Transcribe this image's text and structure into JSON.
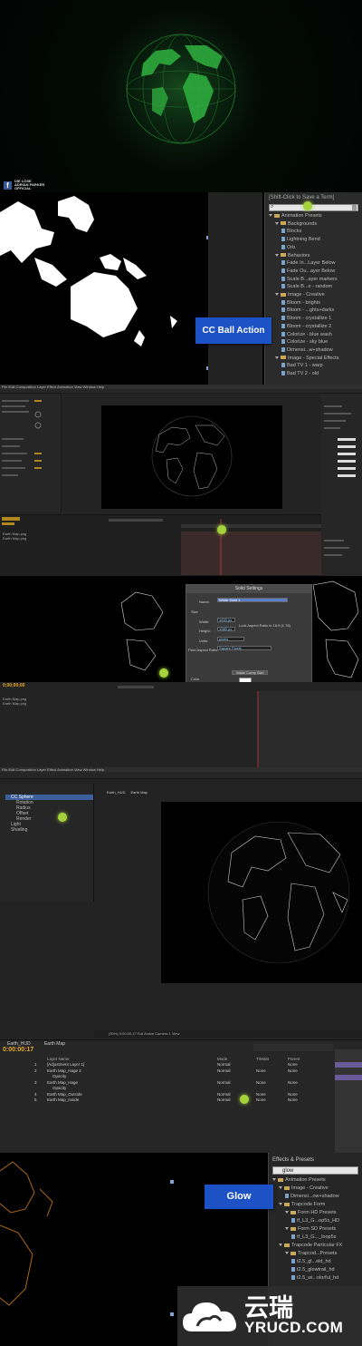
{
  "panel1": {
    "brand_line1": "DIE LOSE",
    "brand_line2": "ADRIAN PARKER",
    "brand_line3": "OFFICIAL"
  },
  "panel2": {
    "search_hint": "[Shift-Click to Save a Term]",
    "callout": "CC Ball Action",
    "tree": [
      {
        "label": "Animation Presets",
        "kind": "folder",
        "indent": 0
      },
      {
        "label": "Backgrounds",
        "kind": "folder",
        "indent": 1
      },
      {
        "label": "Blocks",
        "kind": "file",
        "indent": 2
      },
      {
        "label": "Lightning Bend",
        "kind": "file",
        "indent": 2
      },
      {
        "label": "Orb",
        "kind": "file",
        "indent": 2
      },
      {
        "label": "Behaviors",
        "kind": "folder",
        "indent": 1
      },
      {
        "label": "Fade In...Layer Below",
        "kind": "file",
        "indent": 2
      },
      {
        "label": "Fade Ou...ayer Below",
        "kind": "file",
        "indent": 2
      },
      {
        "label": "Scale B...ayer markers",
        "kind": "file",
        "indent": 2
      },
      {
        "label": "Scale B...e - random",
        "kind": "file",
        "indent": 2
      },
      {
        "label": "Image - Creative",
        "kind": "folder",
        "indent": 1
      },
      {
        "label": "Bloom - brights",
        "kind": "file",
        "indent": 2
      },
      {
        "label": "Bloom - ...ghts+darks",
        "kind": "file",
        "indent": 2
      },
      {
        "label": "Bloom - crystallize 1",
        "kind": "file",
        "indent": 2
      },
      {
        "label": "Bloom - crystallize 2",
        "kind": "file",
        "indent": 2
      },
      {
        "label": "Colorize - blue wash",
        "kind": "file",
        "indent": 2
      },
      {
        "label": "Colorize - sky blue",
        "kind": "file",
        "indent": 2
      },
      {
        "label": "Dimensi...w+shadow",
        "kind": "file",
        "indent": 2
      },
      {
        "label": "Image - Special Effects",
        "kind": "folder",
        "indent": 1
      },
      {
        "label": "Bad TV 1 - warp",
        "kind": "file",
        "indent": 2
      },
      {
        "label": "Bad TV 2 - old",
        "kind": "file",
        "indent": 2
      }
    ]
  },
  "panel3": {
    "menu": "File  Edit  Composition  Layer  Effect  Animation  View  Window  Help",
    "layers": [
      "Earth Map.png",
      "Earth Map.png"
    ]
  },
  "panel4": {
    "dialog_title": "Solid Settings",
    "name_label": "Name:",
    "name_value": "White Solid 1",
    "size_label": "Size",
    "width_label": "Width:",
    "width_value": "1920 px",
    "height_label": "Height:",
    "height_value": "1080 px",
    "units_label": "Units:",
    "units_value": "pixels",
    "par_label": "Pixel Aspect Ratio:",
    "par_value": "Square Pixels",
    "lock_label": "Lock Aspect Ratio to 16:9 (1.78)",
    "make_comp_size": "Make Comp Size",
    "color_label": "Color",
    "preview_label": "Preview",
    "ok": "OK",
    "cancel": "Cancel",
    "timecode": "0;00;00;00",
    "layers": [
      "Earth Map.png",
      "Earth Map.png"
    ]
  },
  "panel5": {
    "menu": "File  Edit  Composition  Layer  Effect  Animation  View  Window  Help",
    "effect_controls": "Effect Controls: Earth Map_Hage",
    "effect_tree": [
      "CC Sphere",
      "Rotation",
      "Radius",
      "Offset",
      "Render",
      "Light",
      "Shading"
    ],
    "comp_tabs": [
      "Earth_HUD",
      "Earth Map"
    ],
    "viewer_bar": "(50%)   0;00;00;17   Full   Active Camera   1 View",
    "timecode": "0:00:00:17",
    "tl_tabs": [
      "Earth_HUD",
      "Earth Map"
    ],
    "columns": {
      "name": "Layer Name",
      "mode": "Mode",
      "trkmat": "TrkMat",
      "parent": "Parent"
    },
    "rows": [
      {
        "num": "1",
        "name": "[Adjustment Layer 1]",
        "mode": "Normal",
        "trk": "",
        "parent": "None"
      },
      {
        "num": "2",
        "name": "Earth Map_Hage 2",
        "mode": "Normal",
        "trk": "None",
        "parent": "None"
      },
      {
        "num": "",
        "name": "Opacity",
        "mode": "",
        "trk": "",
        "parent": ""
      },
      {
        "num": "3",
        "name": "Earth Map_Hage",
        "mode": "Normal",
        "trk": "None",
        "parent": "None"
      },
      {
        "num": "",
        "name": "Opacity",
        "mode": "",
        "trk": "",
        "parent": ""
      },
      {
        "num": "4",
        "name": "Earth Map_Outside",
        "mode": "Normal",
        "trk": "None",
        "parent": "None"
      },
      {
        "num": "5",
        "name": "Earth Map_Inside",
        "mode": "Normal",
        "trk": "None",
        "parent": "None"
      }
    ]
  },
  "panel6": {
    "title": "Effects & Presets",
    "search_value": "glow",
    "callout": "Glow",
    "tree": [
      {
        "label": "Animation Presets",
        "kind": "folder",
        "indent": 0
      },
      {
        "label": "Image - Creative",
        "kind": "folder",
        "indent": 1
      },
      {
        "label": "Dimensi...ow+shadow",
        "kind": "file",
        "indent": 2
      },
      {
        "label": "Trapcode Form",
        "kind": "folder",
        "indent": 1
      },
      {
        "label": "Form HD Presets",
        "kind": "folder",
        "indent": 2
      },
      {
        "label": "tf_L3_G...op5s_HD",
        "kind": "file",
        "indent": 3
      },
      {
        "label": "Form SD Presets",
        "kind": "folder",
        "indent": 2
      },
      {
        "label": "tf_L3_G..._loop5s",
        "kind": "file",
        "indent": 3
      },
      {
        "label": "Trapcode Particular FX",
        "kind": "folder",
        "indent": 1
      },
      {
        "label": "Trapcod...Presets",
        "kind": "folder",
        "indent": 2
      },
      {
        "label": "t2.5_gl...eld_hd",
        "kind": "file",
        "indent": 3
      },
      {
        "label": "t2.5_glowtrail_hd",
        "kind": "file",
        "indent": 3
      },
      {
        "label": "t2.5_wi...olorful_hd",
        "kind": "file",
        "indent": 3
      }
    ],
    "logo_cn": "云瑞",
    "logo_en": "YRUCD.COM"
  }
}
